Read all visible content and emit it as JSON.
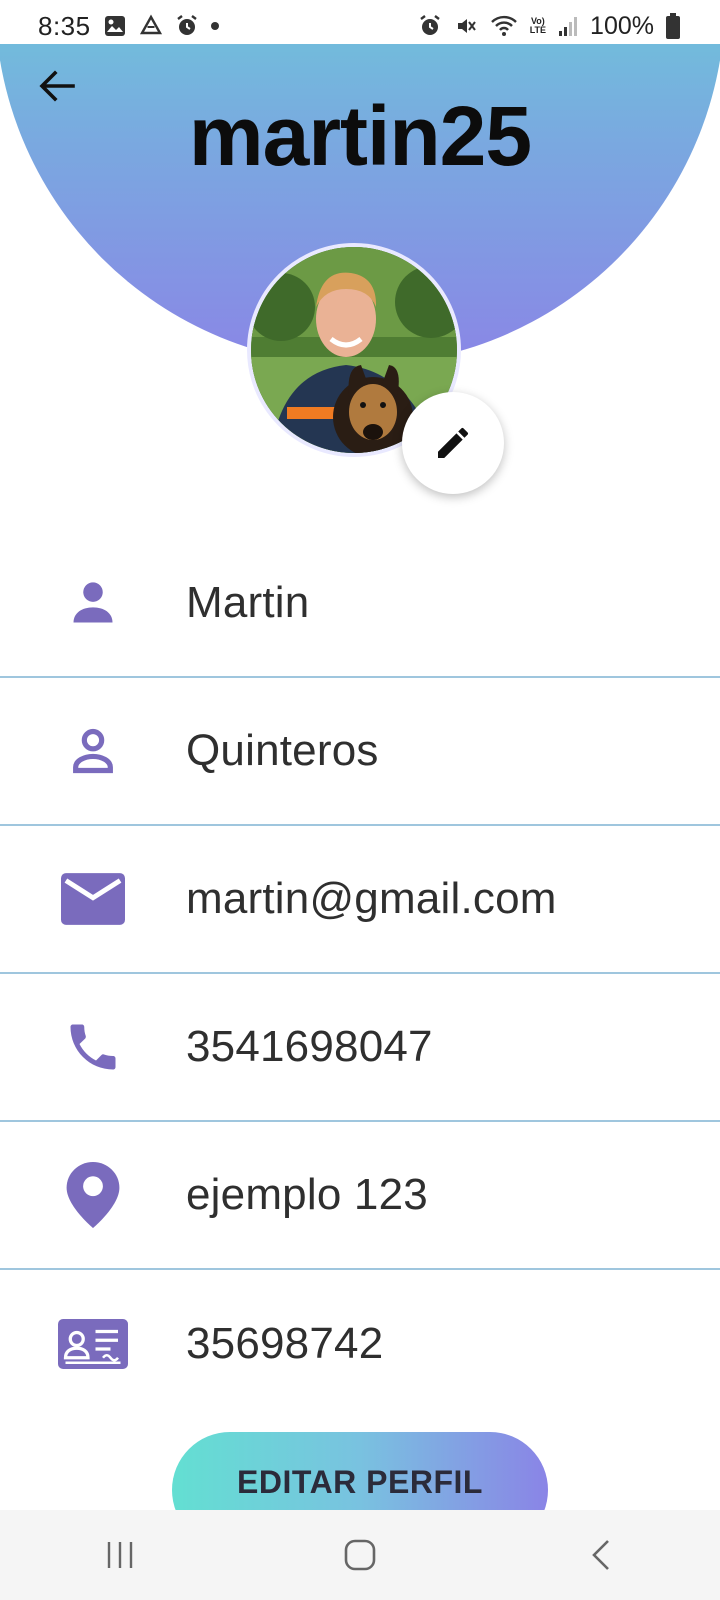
{
  "status_bar": {
    "time": "8:35",
    "battery": "100%",
    "network_label_top": "Vo)",
    "network_label_bottom": "LTE"
  },
  "header": {
    "username": "martin25",
    "gradient_colors": [
      "#63dfd2",
      "#8a86e6"
    ]
  },
  "profile": {
    "fields": [
      {
        "icon": "person-filled-icon",
        "value": "Martin"
      },
      {
        "icon": "person-outline-icon",
        "value": "Quinteros"
      },
      {
        "icon": "mail-icon",
        "value": "martin@gmail.com"
      },
      {
        "icon": "phone-icon",
        "value": "3541698047"
      },
      {
        "icon": "location-pin-icon",
        "value": "ejemplo 123"
      },
      {
        "icon": "id-card-icon",
        "value": "35698742"
      }
    ]
  },
  "actions": {
    "edit_profile_label": "EDITAR PERFIL"
  },
  "theme": {
    "icon_color": "#7a6bbd",
    "divider_color": "#9fc6de"
  }
}
